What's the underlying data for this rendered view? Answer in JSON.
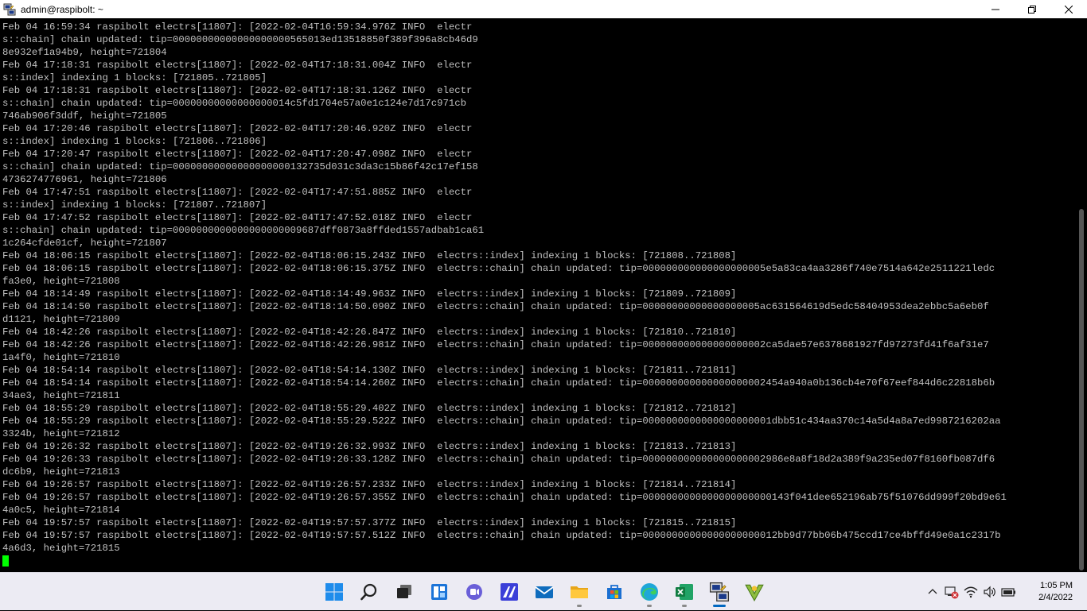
{
  "window": {
    "title": "admin@raspibolt: ~"
  },
  "colors": {
    "terminal_bg": "#000000",
    "terminal_text": "#c0c0c0",
    "cursor": "#00ff00",
    "taskbar_bg": "#ecebf3"
  },
  "terminal": {
    "lines": [
      "Feb 04 16:59:34 raspibolt electrs[11807]: [2022-02-04T16:59:34.976Z INFO  electr",
      "s::chain] chain updated: tip=00000000000000000000565013ed13518850f389f396a8cb46d9",
      "8e932ef1a94b9, height=721804",
      "Feb 04 17:18:31 raspibolt electrs[11807]: [2022-02-04T17:18:31.004Z INFO  electr",
      "s::index] indexing 1 blocks: [721805..721805]",
      "Feb 04 17:18:31 raspibolt electrs[11807]: [2022-02-04T17:18:31.126Z INFO  electr",
      "s::chain] chain updated: tip=00000000000000000014c5fd1704e57a0e1c124e7d17c971cb",
      "746ab906f3ddf, height=721805",
      "Feb 04 17:20:46 raspibolt electrs[11807]: [2022-02-04T17:20:46.920Z INFO  electr",
      "s::index] indexing 1 blocks: [721806..721806]",
      "Feb 04 17:20:47 raspibolt electrs[11807]: [2022-02-04T17:20:47.098Z INFO  electr",
      "s::chain] chain updated: tip=00000000000000000000132735d031c3da3c15b86f42c17ef158",
      "4736274776961, height=721806",
      "Feb 04 17:47:51 raspibolt electrs[11807]: [2022-02-04T17:47:51.885Z INFO  electr",
      "s::index] indexing 1 blocks: [721807..721807]",
      "Feb 04 17:47:52 raspibolt electrs[11807]: [2022-02-04T17:47:52.018Z INFO  electr",
      "s::chain] chain updated: tip=0000000000000000000009687dff0873a8ffded1557adbab1ca61",
      "1c264cfde01cf, height=721807",
      "Feb 04 18:06:15 raspibolt electrs[11807]: [2022-02-04T18:06:15.243Z INFO  electrs::index] indexing 1 blocks: [721808..721808]",
      "Feb 04 18:06:15 raspibolt electrs[11807]: [2022-02-04T18:06:15.375Z INFO  electrs::chain] chain updated: tip=000000000000000000005e5a83ca4aa3286f740e7514a642e2511221ledc",
      "fa3e0, height=721808",
      "Feb 04 18:14:49 raspibolt electrs[11807]: [2022-02-04T18:14:49.963Z INFO  electrs::index] indexing 1 blocks: [721809..721809]",
      "Feb 04 18:14:50 raspibolt electrs[11807]: [2022-02-04T18:14:50.090Z INFO  electrs::chain] chain updated: tip=00000000000000000005ac631564619d5edc58404953dea2ebbc5a6eb0f",
      "d1121, height=721809",
      "Feb 04 18:42:26 raspibolt electrs[11807]: [2022-02-04T18:42:26.847Z INFO  electrs::index] indexing 1 blocks: [721810..721810]",
      "Feb 04 18:42:26 raspibolt electrs[11807]: [2022-02-04T18:42:26.981Z INFO  electrs::chain] chain updated: tip=000000000000000000002ca5dae57e6378681927fd97273fd41f6af31e7",
      "1a4f0, height=721810",
      "Feb 04 18:54:14 raspibolt electrs[11807]: [2022-02-04T18:54:14.130Z INFO  electrs::index] indexing 1 blocks: [721811..721811]",
      "Feb 04 18:54:14 raspibolt electrs[11807]: [2022-02-04T18:54:14.260Z INFO  electrs::chain] chain updated: tip=000000000000000000002454a940a0b136cb4e70f67eef844d6c22818b6b",
      "34ae3, height=721811",
      "Feb 04 18:55:29 raspibolt electrs[11807]: [2022-02-04T18:55:29.402Z INFO  electrs::index] indexing 1 blocks: [721812..721812]",
      "Feb 04 18:55:29 raspibolt electrs[11807]: [2022-02-04T18:55:29.522Z INFO  electrs::chain] chain updated: tip=0000000000000000000001dbb51c434aa370c14a5d4a8a7ed9987216202aa",
      "3324b, height=721812",
      "Feb 04 19:26:32 raspibolt electrs[11807]: [2022-02-04T19:26:32.993Z INFO  electrs::index] indexing 1 blocks: [721813..721813]",
      "Feb 04 19:26:33 raspibolt electrs[11807]: [2022-02-04T19:26:33.128Z INFO  electrs::chain] chain updated: tip=000000000000000000002986e8a8f18d2a389f9a235ed07f8160fb087df6",
      "dc6b9, height=721813",
      "Feb 04 19:26:57 raspibolt electrs[11807]: [2022-02-04T19:26:57.233Z INFO  electrs::index] indexing 1 blocks: [721814..721814]",
      "Feb 04 19:26:57 raspibolt electrs[11807]: [2022-02-04T19:26:57.355Z INFO  electrs::chain] chain updated: tip=0000000000000000000000143f041dee652196ab75f51076dd999f20bd9e61",
      "4a0c5, height=721814",
      "Feb 04 19:57:57 raspibolt electrs[11807]: [2022-02-04T19:57:57.377Z INFO  electrs::index] indexing 1 blocks: [721815..721815]",
      "Feb 04 19:57:57 raspibolt electrs[11807]: [2022-02-04T19:57:57.512Z INFO  electrs::chain] chain updated: tip=00000000000000000000012bb9d77bb06b475ccd17ce4bffd49e0a1c2317b",
      "4a6d3, height=721815"
    ]
  },
  "taskbar": {
    "pinned": [
      {
        "name": "start-button",
        "icon": "windows-logo-icon"
      },
      {
        "name": "search-button",
        "icon": "search-icon"
      },
      {
        "name": "task-view-button",
        "icon": "task-view-icon"
      },
      {
        "name": "widgets-button",
        "icon": "widgets-icon"
      },
      {
        "name": "chat-button",
        "icon": "chat-icon"
      },
      {
        "name": "app-button-1",
        "icon": "app-icon"
      },
      {
        "name": "mail-button",
        "icon": "mail-icon"
      },
      {
        "name": "file-explorer-button",
        "icon": "folder-icon"
      },
      {
        "name": "store-button",
        "icon": "store-icon"
      },
      {
        "name": "edge-button",
        "icon": "edge-icon"
      },
      {
        "name": "excel-button",
        "icon": "excel-icon"
      },
      {
        "name": "putty-button",
        "icon": "putty-icon"
      },
      {
        "name": "wallet-button",
        "icon": "wallet-icon"
      }
    ],
    "tray": [
      {
        "name": "show-hidden-icons",
        "icon": "chevron-up-icon"
      },
      {
        "name": "network-status",
        "icon": "network-error-icon"
      },
      {
        "name": "wifi-status",
        "icon": "wifi-icon"
      },
      {
        "name": "volume-status",
        "icon": "volume-icon"
      },
      {
        "name": "battery-status",
        "icon": "battery-icon"
      }
    ],
    "clock": {
      "time": "1:05 PM",
      "date": "2/4/2022"
    }
  }
}
